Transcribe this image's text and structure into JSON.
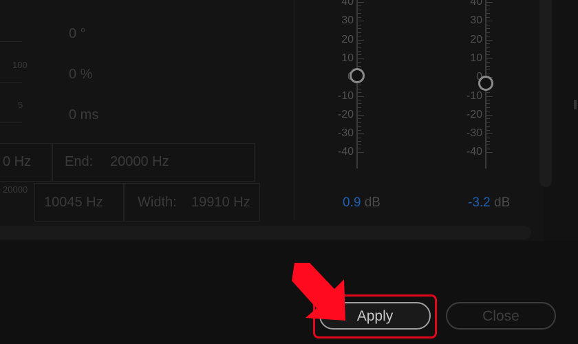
{
  "params": {
    "degree": "0 °",
    "percent": "0 %",
    "ms": "0 ms",
    "small_100": "100",
    "small_5": "5",
    "small_20000": "20000"
  },
  "fields": {
    "start_partial": "0 Hz",
    "end_label": "End:",
    "end_value": "20000 Hz",
    "center_value": "10045 Hz",
    "width_label": "Width:",
    "width_value": "19910 Hz"
  },
  "slider_ticks": [
    "40",
    "30",
    "20",
    "10",
    "0",
    "-10",
    "-20",
    "-30",
    "-40"
  ],
  "left_slider": {
    "gain_value": "0.9",
    "gain_unit": "dB",
    "level_db": 0.9
  },
  "right_slider": {
    "gain_value": "-3.2",
    "gain_unit": "dB",
    "level_db": -3.2
  },
  "buttons": {
    "apply": "Apply",
    "close": "Close"
  },
  "colors": {
    "accent_blue": "#1f5fb3",
    "highlight_red": "#e0081a",
    "arrow_red": "#ff0a1e"
  },
  "icons": {
    "pointer": "red-arrow-icon"
  }
}
